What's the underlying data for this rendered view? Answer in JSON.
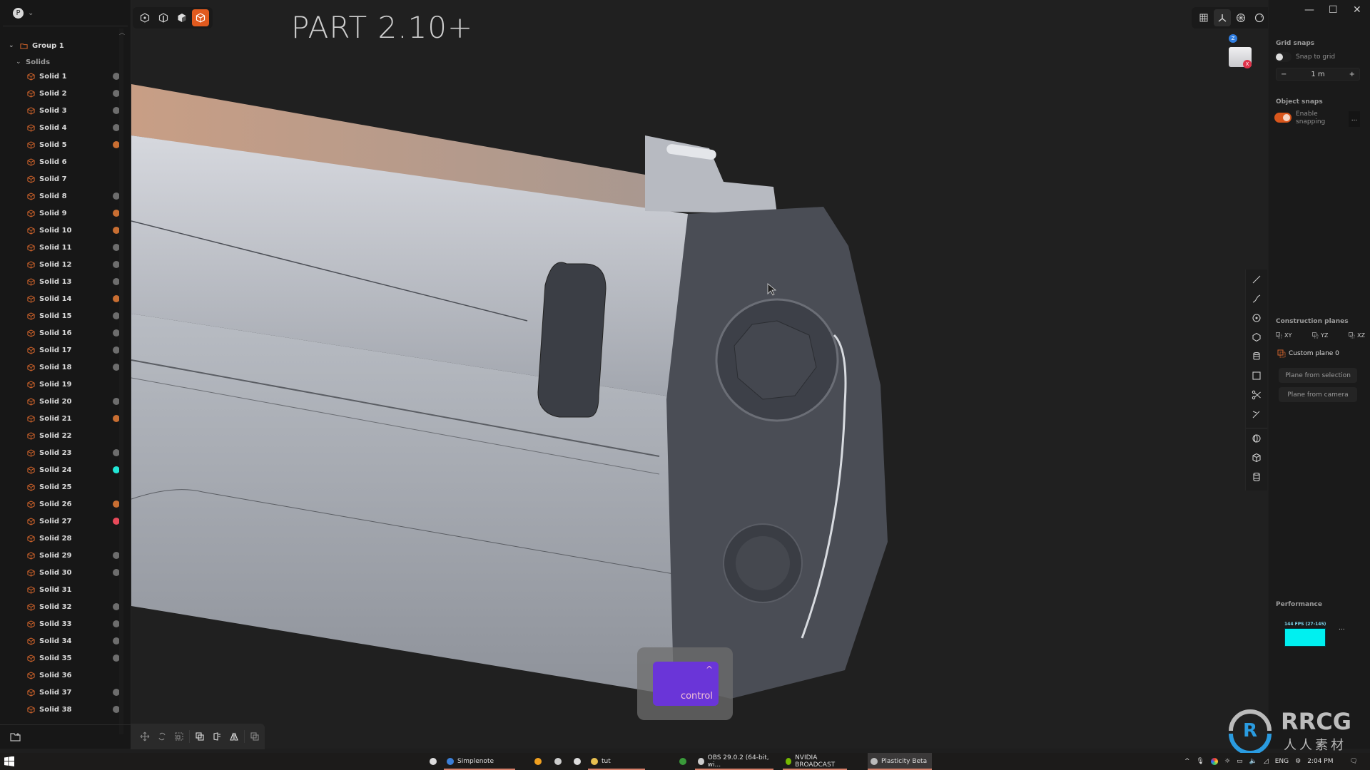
{
  "app": {
    "title": "PART 2.10+",
    "profile_initial": "P"
  },
  "colors": {
    "accent": "#e15a1e",
    "cube_icon": "#d0632a",
    "dot_gray": "#6d6d6d",
    "dot_orange": "#c86e32",
    "dot_cyan": "#22e6d6",
    "dot_red": "#e84a5a",
    "fps_bar": "#00f0f0",
    "key_overlay": "#6a35d8"
  },
  "outliner": {
    "group_label": "Group 1",
    "folder_label": "Solids",
    "items": [
      {
        "label": "Solid 1",
        "dot": "gray"
      },
      {
        "label": "Solid 2",
        "dot": "gray"
      },
      {
        "label": "Solid 3",
        "dot": "gray"
      },
      {
        "label": "Solid 4",
        "dot": "gray"
      },
      {
        "label": "Solid 5",
        "dot": "orange"
      },
      {
        "label": "Solid 6",
        "dot": "none"
      },
      {
        "label": "Solid 7",
        "dot": "none"
      },
      {
        "label": "Solid 8",
        "dot": "gray"
      },
      {
        "label": "Solid 9",
        "dot": "orange"
      },
      {
        "label": "Solid 10",
        "dot": "orange"
      },
      {
        "label": "Solid 11",
        "dot": "gray"
      },
      {
        "label": "Solid 12",
        "dot": "gray"
      },
      {
        "label": "Solid 13",
        "dot": "gray"
      },
      {
        "label": "Solid 14",
        "dot": "orange"
      },
      {
        "label": "Solid 15",
        "dot": "gray"
      },
      {
        "label": "Solid 16",
        "dot": "gray"
      },
      {
        "label": "Solid 17",
        "dot": "gray"
      },
      {
        "label": "Solid 18",
        "dot": "gray"
      },
      {
        "label": "Solid 19",
        "dot": "none"
      },
      {
        "label": "Solid 20",
        "dot": "gray"
      },
      {
        "label": "Solid 21",
        "dot": "orange"
      },
      {
        "label": "Solid 22",
        "dot": "none"
      },
      {
        "label": "Solid 23",
        "dot": "gray"
      },
      {
        "label": "Solid 24",
        "dot": "cyan"
      },
      {
        "label": "Solid 25",
        "dot": "none"
      },
      {
        "label": "Solid 26",
        "dot": "orange"
      },
      {
        "label": "Solid 27",
        "dot": "red"
      },
      {
        "label": "Solid 28",
        "dot": "none"
      },
      {
        "label": "Solid 29",
        "dot": "gray"
      },
      {
        "label": "Solid 30",
        "dot": "gray"
      },
      {
        "label": "Solid 31",
        "dot": "none"
      },
      {
        "label": "Solid 32",
        "dot": "gray"
      },
      {
        "label": "Solid 33",
        "dot": "gray"
      },
      {
        "label": "Solid 34",
        "dot": "gray"
      },
      {
        "label": "Solid 35",
        "dot": "gray"
      },
      {
        "label": "Solid 36",
        "dot": "none"
      },
      {
        "label": "Solid 37",
        "dot": "gray"
      },
      {
        "label": "Solid 38",
        "dot": "gray"
      }
    ]
  },
  "top_toolbar": {
    "select_modes": [
      "vertex-select-icon",
      "edge-select-icon",
      "face-select-icon",
      "solid-select-icon"
    ],
    "active_mode": "solid-select-icon",
    "view_tools": [
      "grid-icon",
      "axes-icon",
      "wireframe-sphere-icon",
      "render-mode-icon"
    ],
    "active_view_tool": "axes-icon"
  },
  "viewcube": {
    "z_label": "Z",
    "x_label": "X"
  },
  "right_panel": {
    "grid_snaps": {
      "title": "Grid snaps",
      "snap_to_grid_label": "Snap to grid",
      "snap_to_grid_on": false,
      "step_value": "1 m",
      "minus": "−",
      "plus": "+"
    },
    "object_snaps": {
      "title": "Object snaps",
      "enable_label_1": "Enable",
      "enable_label_2": "snapping",
      "enabled": true,
      "more": "..."
    },
    "construction_planes": {
      "title": "Construction planes",
      "planes": [
        "XY",
        "YZ",
        "XZ"
      ],
      "custom_plane": "Custom plane 0",
      "from_selection": "Plane from selection",
      "from_camera": "Plane from camera"
    },
    "performance": {
      "title": "Performance",
      "fps_text": "144 FPS (27-145)",
      "more": "..."
    }
  },
  "tool_strip": [
    "line-icon",
    "curve-icon",
    "circle-icon",
    "polygon-icon",
    "cylinder-stack-icon",
    "rectangle-icon",
    "scissors-icon",
    "trim-icon",
    "sphere-icon",
    "box-icon",
    "cylinder-icon"
  ],
  "bottom_toolbar": [
    "move-icon",
    "rotate-icon",
    "scale-icon",
    "boolean-icon",
    "offset-icon",
    "mirror-icon",
    "duplicate-icon"
  ],
  "key_overlay": {
    "caret": "^",
    "label": "control"
  },
  "taskbar": {
    "apps": [
      {
        "icon": "app-icon",
        "label": ""
      },
      {
        "icon": "simplenote-icon",
        "label": "Simplenote"
      },
      {
        "icon": "warning-app-icon",
        "label": ""
      },
      {
        "icon": "webcam-icon",
        "label": ""
      },
      {
        "icon": "chat-icon",
        "label": ""
      },
      {
        "icon": "folder-icon",
        "label": "tut"
      },
      {
        "icon": "chrome-icon",
        "label": ""
      },
      {
        "icon": "obs-icon",
        "label": "OBS 29.0.2 (64-bit, wi..."
      },
      {
        "icon": "nvidia-icon",
        "label": "NVIDIA BROADCAST"
      },
      {
        "icon": "plasticity-icon",
        "label": "Plasticity Beta"
      }
    ],
    "tray": {
      "language": "ENG",
      "time": "2:04 PM"
    }
  },
  "watermark": {
    "brand": "RRCG",
    "subtitle": "人人素材"
  }
}
